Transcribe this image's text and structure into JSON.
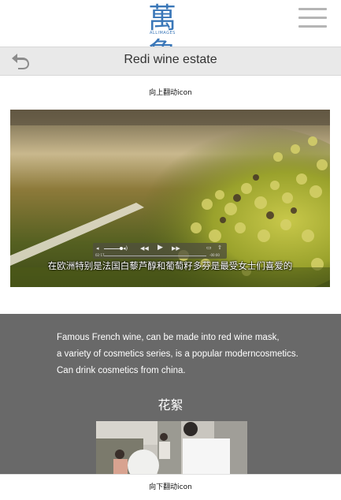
{
  "header": {
    "logo_cn": "萬象",
    "logo_en": "ALLIMAGES"
  },
  "titlebar": {
    "title": "Redi wine estate"
  },
  "hints": {
    "scroll_up": "向上翻动icon",
    "scroll_down": "向下翻动icon"
  },
  "video": {
    "subtitle": "在欧洲特别是法国白藜芦醇和葡萄籽多芬是最受女士们喜爱的",
    "time_elapsed": "02:17",
    "time_remaining": "-00:00"
  },
  "description": {
    "lines": [
      "Famous French wine, can be made into red wine mask,",
      "a variety of cosmetics series, is a popular moderncosmetics.",
      "Can drink cosmetics from china."
    ]
  },
  "gallery": {
    "heading": "花絮"
  },
  "colors": {
    "brand_blue": "#3a77b8",
    "section_grey": "#696969",
    "titlebar_bg": "#e9e9e9"
  }
}
